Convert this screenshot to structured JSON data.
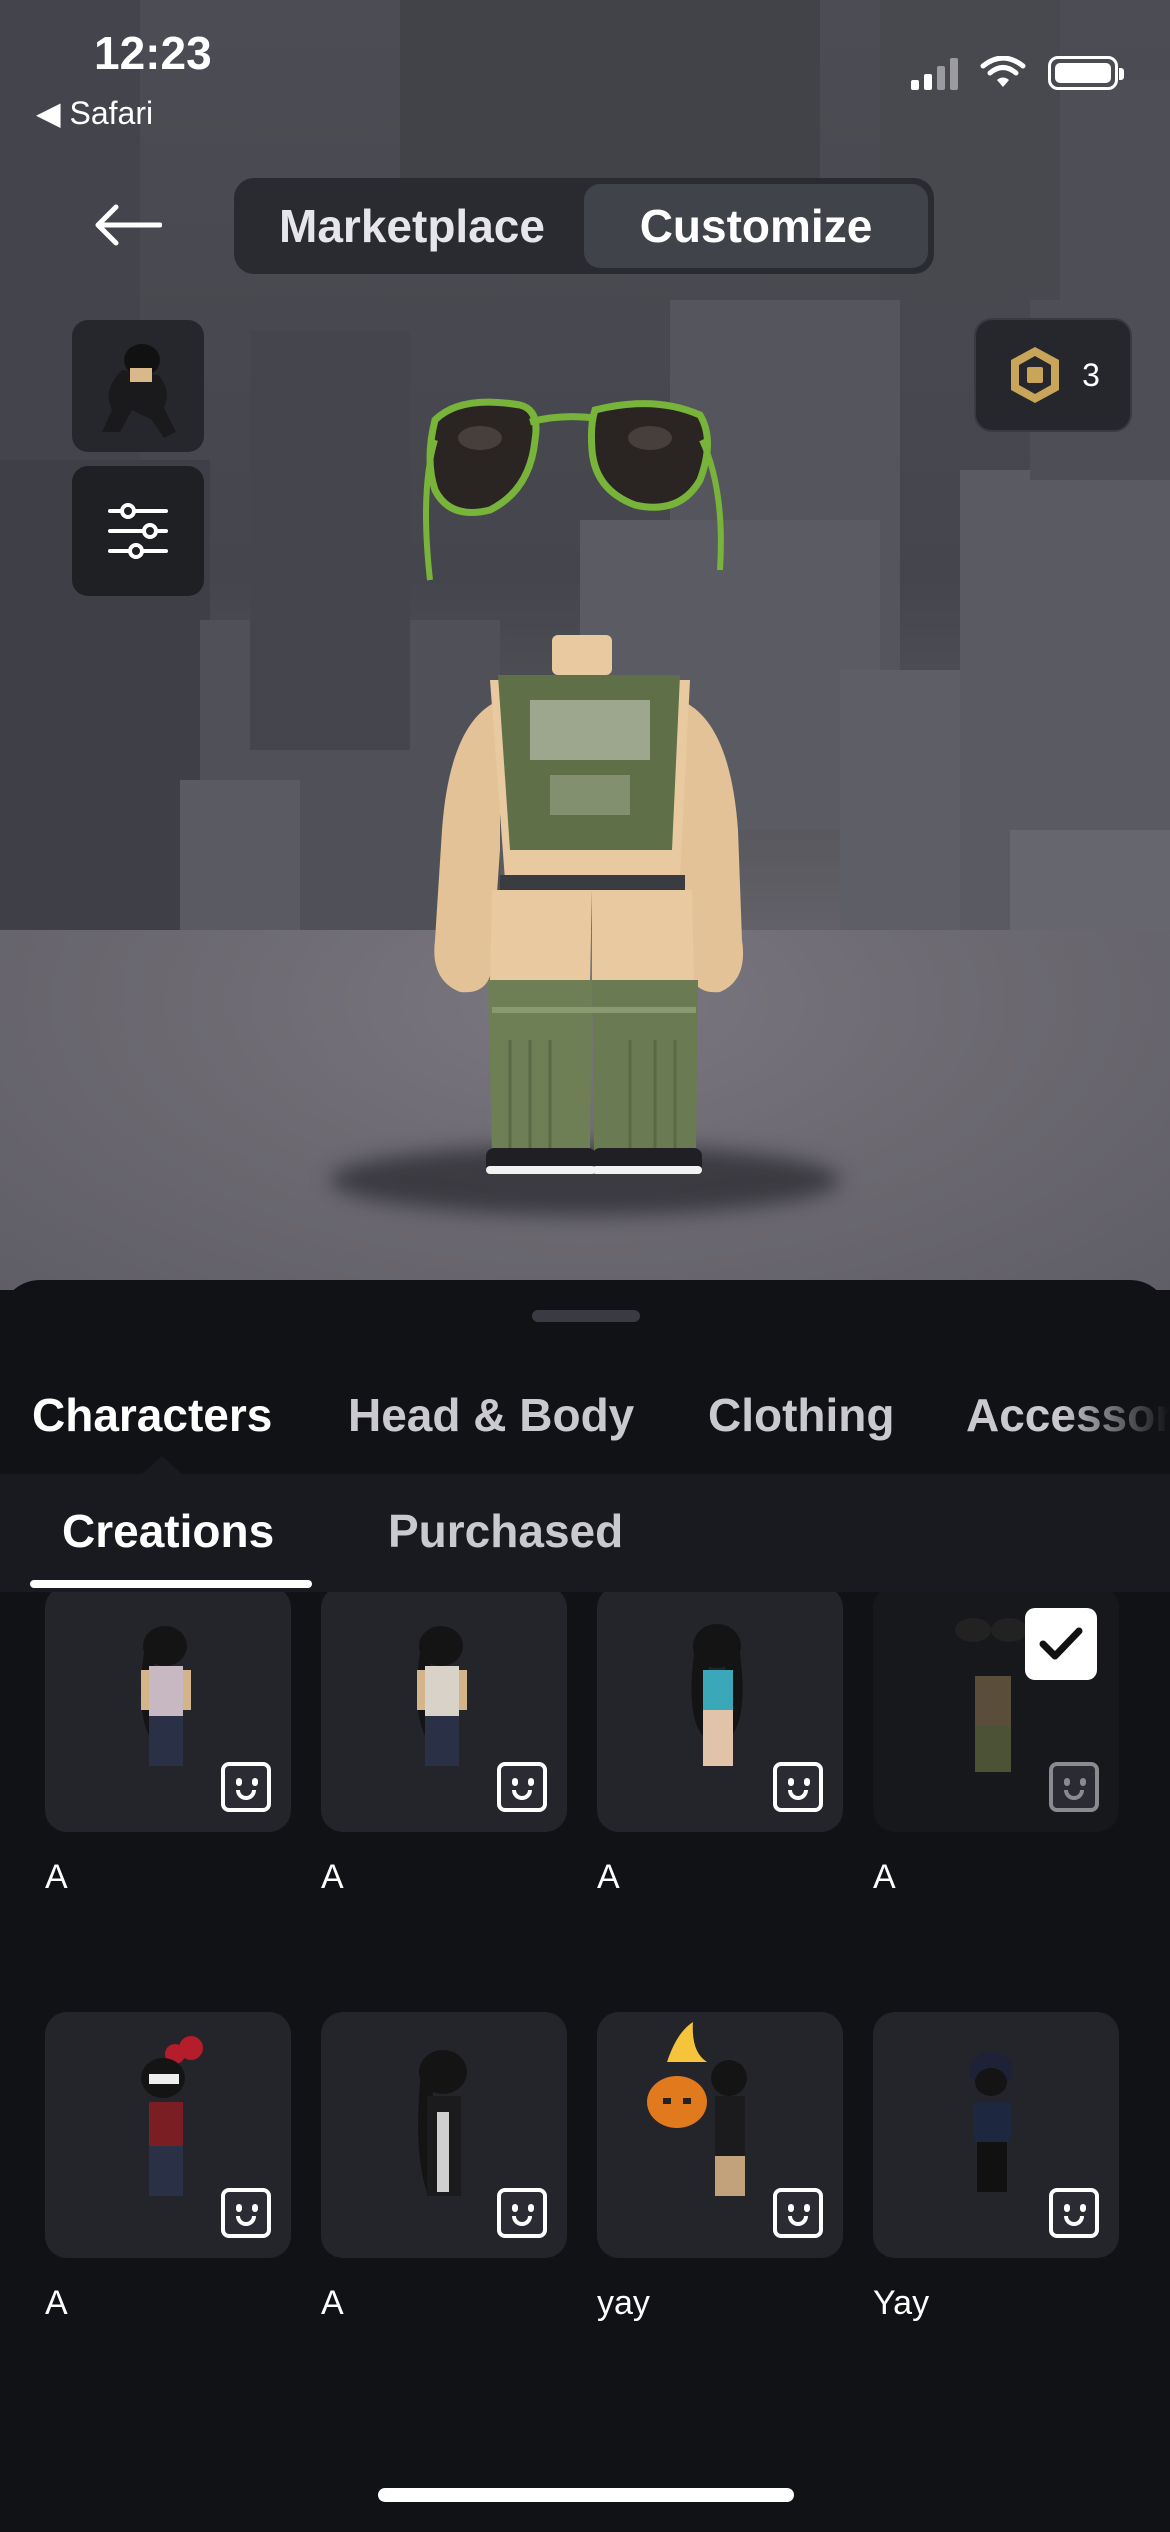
{
  "status_bar": {
    "time": "12:23",
    "back_app": "◀ Safari"
  },
  "header": {
    "segments": [
      {
        "label": "Marketplace",
        "active": false
      },
      {
        "label": "Customize",
        "active": true
      }
    ],
    "robux_count": "3"
  },
  "category_tabs": [
    {
      "label": "Characters",
      "active": true
    },
    {
      "label": "Head & Body",
      "active": false
    },
    {
      "label": "Clothing",
      "active": false
    },
    {
      "label": "Accessories",
      "active": false
    }
  ],
  "sub_tabs": [
    {
      "label": "Creations",
      "active": true
    },
    {
      "label": "Purchased",
      "active": false
    }
  ],
  "characters": [
    {
      "name": "A",
      "selected": false
    },
    {
      "name": "A",
      "selected": false
    },
    {
      "name": "A",
      "selected": false
    },
    {
      "name": "A",
      "selected": true
    },
    {
      "name": "A",
      "selected": false
    },
    {
      "name": "A",
      "selected": false
    },
    {
      "name": "yay",
      "selected": false
    },
    {
      "name": "Yay",
      "selected": false
    }
  ],
  "icons": [
    "back-arrow-icon",
    "avatar-thumbnail-icon",
    "sliders-icon",
    "robux-icon",
    "emote-face-icon",
    "checkmark-icon"
  ]
}
